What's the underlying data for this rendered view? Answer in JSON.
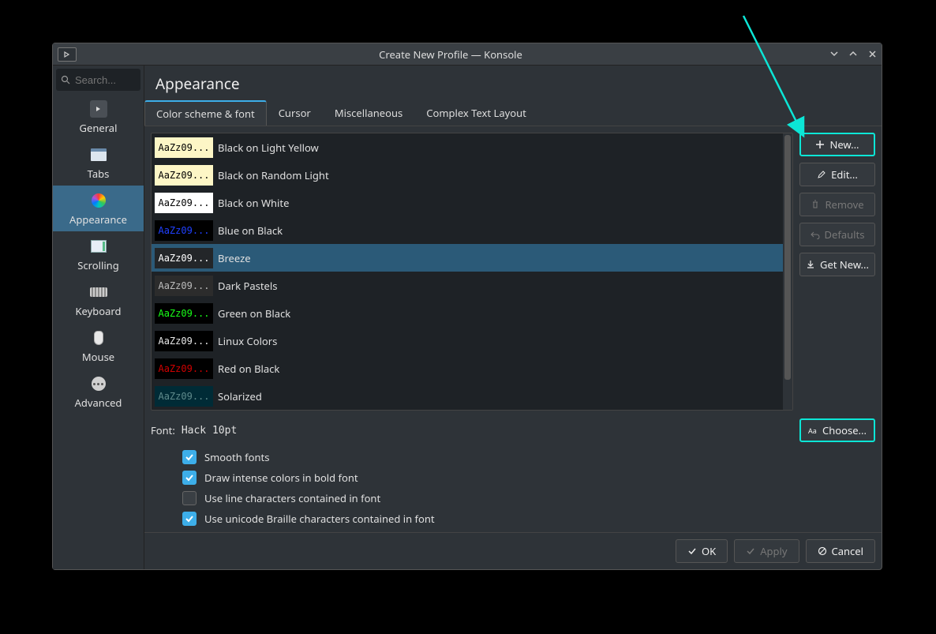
{
  "window": {
    "title": "Create New Profile — Konsole"
  },
  "search": {
    "placeholder": "Search..."
  },
  "sidebar": {
    "items": [
      {
        "label": "General"
      },
      {
        "label": "Tabs"
      },
      {
        "label": "Appearance"
      },
      {
        "label": "Scrolling"
      },
      {
        "label": "Keyboard"
      },
      {
        "label": "Mouse"
      },
      {
        "label": "Advanced"
      }
    ],
    "active_index": 2
  },
  "page": {
    "title": "Appearance"
  },
  "tabs": {
    "items": [
      {
        "label": "Color scheme & font"
      },
      {
        "label": "Cursor"
      },
      {
        "label": "Miscellaneous"
      },
      {
        "label": "Complex Text Layout"
      }
    ],
    "active_index": 0
  },
  "schemes": {
    "sample_text": "AaZz09...",
    "selected_index": 4,
    "items": [
      {
        "name": "Black on Light Yellow",
        "bg": "#fdf6c6",
        "fg": "#000000"
      },
      {
        "name": "Black on Random Light",
        "bg": "#fdf6c6",
        "fg": "#000000"
      },
      {
        "name": "Black on White",
        "bg": "#ffffff",
        "fg": "#000000"
      },
      {
        "name": "Blue on Black",
        "bg": "#000000",
        "fg": "#2040ff"
      },
      {
        "name": "Breeze",
        "bg": "#232629",
        "fg": "#ffffff"
      },
      {
        "name": "Dark Pastels",
        "bg": "#2c2c2c",
        "fg": "#bbbbbb"
      },
      {
        "name": "Green on Black",
        "bg": "#000000",
        "fg": "#18ff18"
      },
      {
        "name": "Linux Colors",
        "bg": "#000000",
        "fg": "#e8e8e8"
      },
      {
        "name": "Red on Black",
        "bg": "#000000",
        "fg": "#d10000"
      },
      {
        "name": "Solarized",
        "bg": "#002b36",
        "fg": "#5f8a8b"
      }
    ]
  },
  "scheme_buttons": {
    "new": "New...",
    "edit": "Edit...",
    "remove": "Remove",
    "defaults": "Defaults",
    "get_new": "Get New..."
  },
  "font": {
    "label": "Font:",
    "value": "Hack 10pt",
    "choose": "Choose..."
  },
  "checks": [
    {
      "label": "Smooth fonts",
      "checked": true
    },
    {
      "label": "Draw intense colors in bold font",
      "checked": true
    },
    {
      "label": "Use line characters contained in font",
      "checked": false
    },
    {
      "label": "Use unicode Braille characters contained in font",
      "checked": true
    }
  ],
  "footer": {
    "ok": "OK",
    "apply": "Apply",
    "cancel": "Cancel"
  },
  "accent": "#0ce6d6"
}
